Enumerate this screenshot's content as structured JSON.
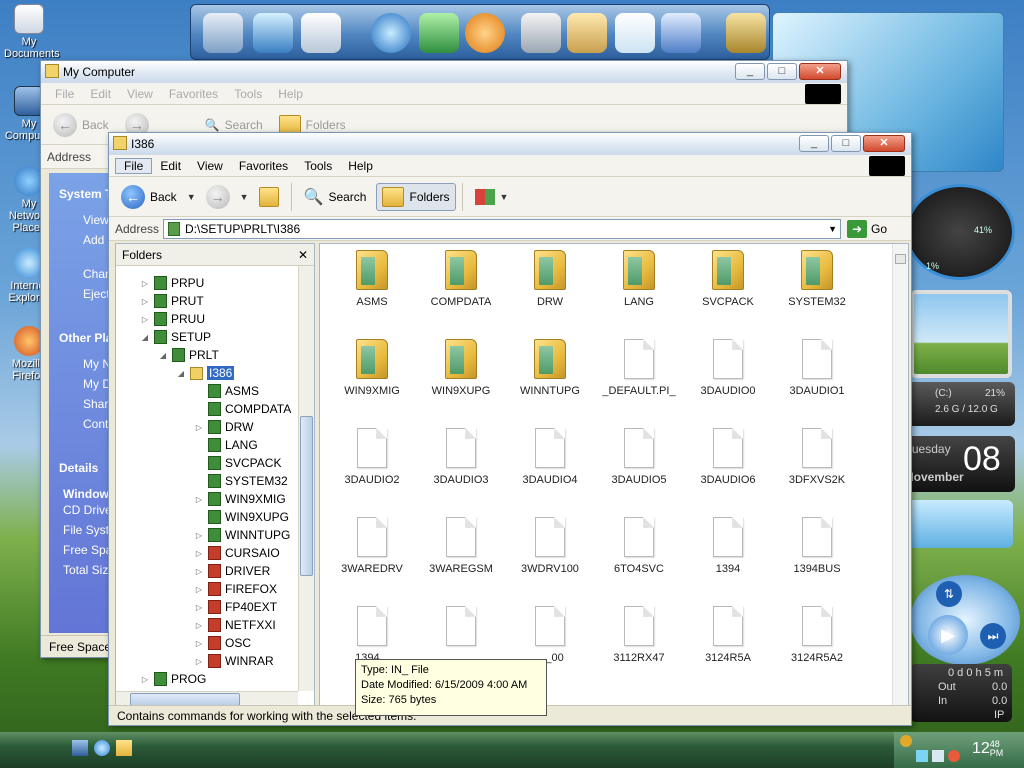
{
  "desktop": {
    "icons": [
      "My Documents",
      "My Computer",
      "My Network Places",
      "Internet Explorer",
      "Mozilla Firefox"
    ]
  },
  "back_window": {
    "title": "My Computer",
    "menu": [
      "File",
      "Edit",
      "View",
      "Favorites",
      "Tools",
      "Help"
    ],
    "toolbar": {
      "back": "Back",
      "search": "Search",
      "folders": "Folders"
    },
    "address_label": "Address",
    "system_tasks_title": "System Tasks",
    "system_tasks": [
      "View",
      "Add or remove programs",
      "Change",
      "Eject"
    ],
    "other_places_title": "Other Places",
    "other_places": [
      "My Network Places",
      "My Documents",
      "Shared Documents",
      "Control Panel"
    ],
    "details_title": "Details",
    "details": [
      "Windows",
      "CD Drive",
      "File System",
      "Free Space",
      "Total Size"
    ],
    "status": "Free Space"
  },
  "window": {
    "title": "I386",
    "menu": [
      "File",
      "Edit",
      "View",
      "Favorites",
      "Tools",
      "Help"
    ],
    "toolbar": {
      "back": "Back",
      "search": "Search",
      "folders": "Folders"
    },
    "address_label": "Address",
    "address_value": "D:\\SETUP\\PRLT\\I386",
    "go_label": "Go",
    "folders_pane_title": "Folders",
    "tree": [
      {
        "label": "PRPU",
        "level": 0,
        "icon": "green"
      },
      {
        "label": "PRUT",
        "level": 0,
        "icon": "green"
      },
      {
        "label": "PRUU",
        "level": 0,
        "icon": "green"
      },
      {
        "label": "SETUP",
        "level": 0,
        "icon": "green"
      },
      {
        "label": "PRLT",
        "level": 1,
        "icon": "green"
      },
      {
        "label": "I386",
        "level": 2,
        "icon": "folder"
      },
      {
        "label": "ASMS",
        "level": 3,
        "icon": "green"
      },
      {
        "label": "COMPDATA",
        "level": 3,
        "icon": "green"
      },
      {
        "label": "DRW",
        "level": 3,
        "icon": "green"
      },
      {
        "label": "LANG",
        "level": 3,
        "icon": "green"
      },
      {
        "label": "SVCPACK",
        "level": 3,
        "icon": "green"
      },
      {
        "label": "SYSTEM32",
        "level": 3,
        "icon": "green"
      },
      {
        "label": "WIN9XMIG",
        "level": 3,
        "icon": "green"
      },
      {
        "label": "WIN9XUPG",
        "level": 3,
        "icon": "green"
      },
      {
        "label": "WINNTUPG",
        "level": 3,
        "icon": "green"
      },
      {
        "label": "CURSAIO",
        "level": 3,
        "icon": "red"
      },
      {
        "label": "DRIVER",
        "level": 3,
        "icon": "red"
      },
      {
        "label": "FIREFOX",
        "level": 3,
        "icon": "red"
      },
      {
        "label": "FP40EXT",
        "level": 3,
        "icon": "red"
      },
      {
        "label": "NETFXXI",
        "level": 3,
        "icon": "red"
      },
      {
        "label": "OSC",
        "level": 3,
        "icon": "red"
      },
      {
        "label": "WINRAR",
        "level": 3,
        "icon": "red"
      },
      {
        "label": "PROG",
        "level": 0,
        "icon": "green"
      }
    ],
    "items": [
      {
        "label": "ASMS",
        "type": "folder"
      },
      {
        "label": "COMPDATA",
        "type": "folder"
      },
      {
        "label": "DRW",
        "type": "folder"
      },
      {
        "label": "LANG",
        "type": "folder"
      },
      {
        "label": "SVCPACK",
        "type": "folder"
      },
      {
        "label": "SYSTEM32",
        "type": "folder"
      },
      {
        "label": "WIN9XMIG",
        "type": "folder"
      },
      {
        "label": "WIN9XUPG",
        "type": "folder"
      },
      {
        "label": "WINNTUPG",
        "type": "folder"
      },
      {
        "label": "_DEFAULT.PI_",
        "type": "file"
      },
      {
        "label": "3DAUDIO0",
        "type": "file"
      },
      {
        "label": "3DAUDIO1",
        "type": "file"
      },
      {
        "label": "3DAUDIO2",
        "type": "file"
      },
      {
        "label": "3DAUDIO3",
        "type": "file"
      },
      {
        "label": "3DAUDIO4",
        "type": "file"
      },
      {
        "label": "3DAUDIO5",
        "type": "file"
      },
      {
        "label": "3DAUDIO6",
        "type": "file"
      },
      {
        "label": "3DFXVS2K",
        "type": "file"
      },
      {
        "label": "3WAREDRV",
        "type": "file"
      },
      {
        "label": "3WAREGSM",
        "type": "file"
      },
      {
        "label": "3WDRV100",
        "type": "file"
      },
      {
        "label": "6TO4SVC",
        "type": "file"
      },
      {
        "label": "1394",
        "type": "file"
      },
      {
        "label": "1394BUS",
        "type": "file"
      },
      {
        "label": "1394...",
        "type": "file"
      },
      {
        "label": "",
        "type": "file"
      },
      {
        "label": "..._00",
        "type": "file"
      },
      {
        "label": "3112RX47",
        "type": "file"
      },
      {
        "label": "3124R5A",
        "type": "file"
      },
      {
        "label": "3124R5A2",
        "type": "file"
      }
    ],
    "tooltip": {
      "type": "Type: IN_ File",
      "modified": "Date Modified: 6/15/2009 4:00 AM",
      "size": "Size: 765 bytes"
    },
    "status": "Contains commands for working with the selected items."
  },
  "widgets": {
    "cpu_percent": "1%",
    "mem_percent": "41%",
    "drive_label": "(C:)",
    "drive_percent": "21%",
    "drive_usage": "2.6 G / 12.0 G",
    "day": "Tuesday",
    "date_day": "08",
    "month": "November",
    "net_time": "0 d 0 h 5 m",
    "net_out_label": "Out",
    "net_out": "0.0",
    "net_in_label": "In",
    "net_in": "0.0",
    "net_ip": "IP"
  },
  "taskbar": {
    "clock": "12",
    "clock_min": "48",
    "clock_ampm": "PM"
  }
}
